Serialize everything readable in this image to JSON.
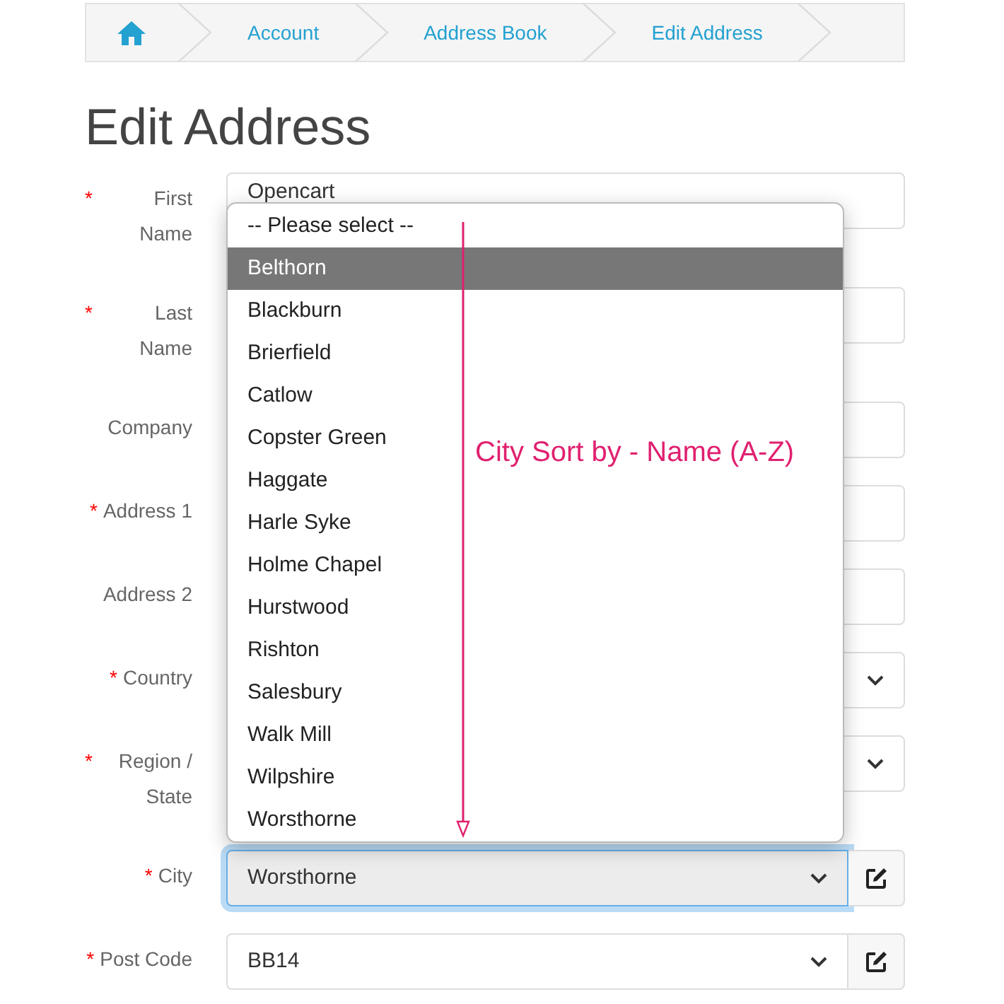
{
  "breadcrumb": [
    {
      "kind": "home"
    },
    {
      "kind": "link",
      "label": "Account"
    },
    {
      "kind": "link",
      "label": "Address Book"
    },
    {
      "kind": "link",
      "label": "Edit Address"
    }
  ],
  "heading": "Edit Address",
  "fields": [
    {
      "required_mark": "*",
      "label": "First Name",
      "kind": "text",
      "value": "Opencart"
    },
    {
      "required_mark": "*",
      "label": "Last Name",
      "kind": "text"
    },
    {
      "label": "Company",
      "kind": "text"
    },
    {
      "required_mark": "*",
      "label": "Address 1",
      "kind": "text"
    },
    {
      "label": "Address 2",
      "kind": "text"
    },
    {
      "required_mark": "*",
      "label": "Country",
      "kind": "select"
    },
    {
      "required_mark": "*",
      "label": "Region / State",
      "kind": "select"
    },
    {
      "required_mark": "*",
      "label": "City",
      "kind": "select_edit",
      "value": "Worsthorne",
      "focused": true
    },
    {
      "required_mark": "*",
      "label": "Post Code",
      "kind": "select_edit",
      "value": "BB14",
      "focused": false
    }
  ],
  "city_dropdown": {
    "options": [
      {
        "label": "-- Please select --",
        "highlighted": false
      },
      {
        "label": "Belthorn",
        "highlighted": true
      },
      {
        "label": "Blackburn",
        "highlighted": false
      },
      {
        "label": "Brierfield",
        "highlighted": false
      },
      {
        "label": "Catlow",
        "highlighted": false
      },
      {
        "label": "Copster Green",
        "highlighted": false
      },
      {
        "label": "Haggate",
        "highlighted": false
      },
      {
        "label": "Harle Syke",
        "highlighted": false
      },
      {
        "label": "Holme Chapel",
        "highlighted": false
      },
      {
        "label": "Hurstwood",
        "highlighted": false
      },
      {
        "label": "Rishton",
        "highlighted": false
      },
      {
        "label": "Salesbury",
        "highlighted": false
      },
      {
        "label": "Walk Mill",
        "highlighted": false
      },
      {
        "label": "Wilpshire",
        "highlighted": false
      },
      {
        "label": "Worsthorne",
        "highlighted": false
      }
    ]
  },
  "annotation": {
    "text": "City Sort by - Name (A-Z)"
  }
}
